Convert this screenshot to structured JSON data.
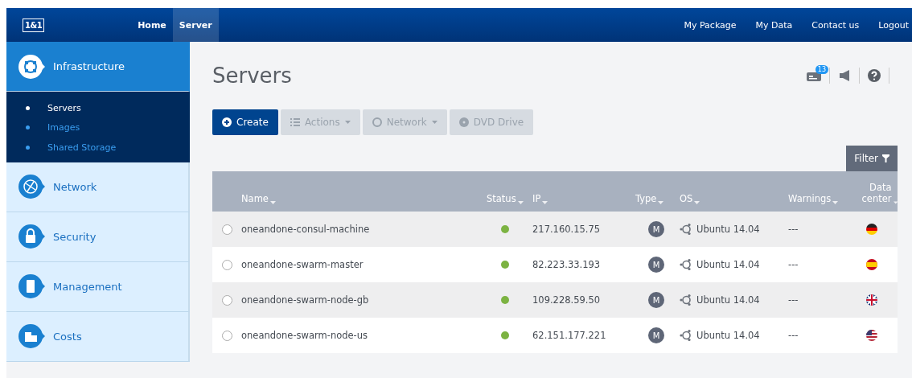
{
  "header": {
    "logo": "1&1",
    "nav": [
      {
        "label": "Home",
        "selected": false
      },
      {
        "label": "Server",
        "selected": true
      }
    ],
    "links": [
      "My Package",
      "My Data",
      "Contact us",
      "Logout"
    ]
  },
  "sidebar": {
    "sections": [
      {
        "label": "Infrastructure",
        "kind": "infrastructure",
        "selected": true,
        "children": [
          {
            "label": "Servers",
            "selected": true
          },
          {
            "label": "Images",
            "selected": false
          },
          {
            "label": "Shared Storage",
            "selected": false
          }
        ]
      },
      {
        "label": "Network",
        "kind": "network",
        "selected": false
      },
      {
        "label": "Security",
        "kind": "security",
        "selected": false
      },
      {
        "label": "Management",
        "kind": "management",
        "selected": false
      },
      {
        "label": "Costs",
        "kind": "costs",
        "selected": false
      }
    ]
  },
  "page": {
    "title": "Servers",
    "notifications": "13"
  },
  "toolbar": [
    {
      "label": "Create",
      "kind": "create",
      "disabled": false
    },
    {
      "label": "Actions",
      "kind": "actions",
      "disabled": true
    },
    {
      "label": "Network",
      "kind": "network",
      "disabled": true
    },
    {
      "label": "DVD Drive",
      "kind": "dvd",
      "disabled": true
    }
  ],
  "filter": "Filter",
  "table": {
    "columns": [
      "Name",
      "Status",
      "IP",
      "Type",
      "OS",
      "Warnings",
      "Data center"
    ],
    "rows": [
      {
        "selected": false,
        "name": "oneandone-consul-machine",
        "status": {
          "color": "#7cb342"
        },
        "ip": "217.160.15.75",
        "type": "M",
        "os": "Ubuntu 14.04",
        "warnings": "---",
        "data_center": {
          "kind": "de"
        }
      },
      {
        "selected": false,
        "name": "oneandone-swarm-master",
        "status": {
          "color": "#7cb342"
        },
        "ip": "82.223.33.193",
        "type": "M",
        "os": "Ubuntu 14.04",
        "warnings": "---",
        "data_center": {
          "kind": "es"
        }
      },
      {
        "selected": false,
        "name": "oneandone-swarm-node-gb",
        "status": {
          "color": "#7cb342"
        },
        "ip": "109.228.59.50",
        "type": "M",
        "os": "Ubuntu 14.04",
        "warnings": "---",
        "data_center": {
          "kind": "gb"
        }
      },
      {
        "selected": false,
        "name": "oneandone-swarm-node-us",
        "status": {
          "color": "#7cb342"
        },
        "ip": "62.151.177.221",
        "type": "M",
        "os": "Ubuntu 14.04",
        "warnings": "---",
        "data_center": {
          "kind": "us"
        }
      }
    ]
  }
}
